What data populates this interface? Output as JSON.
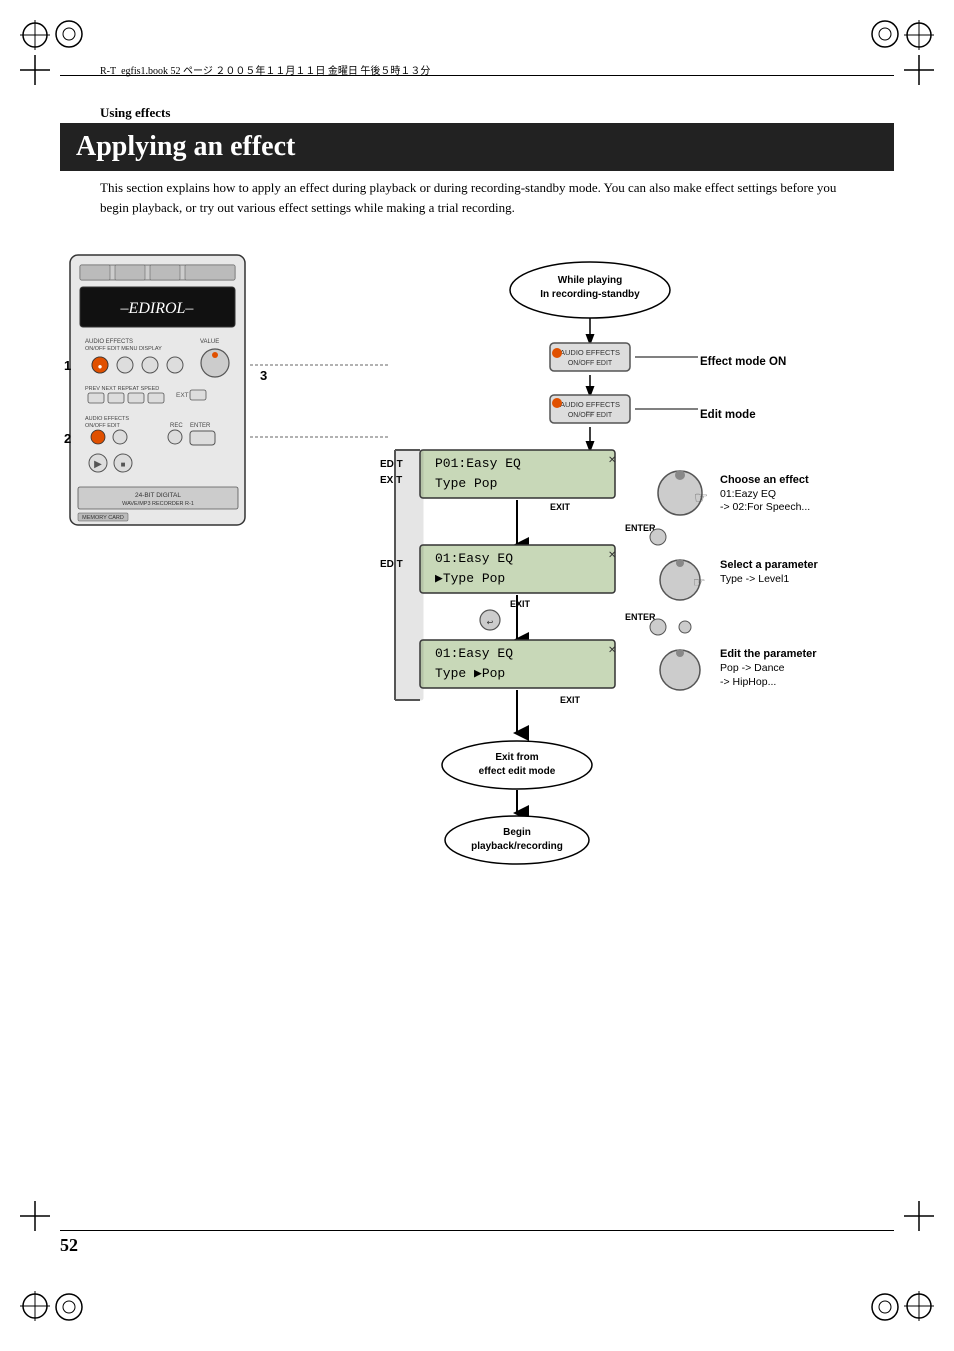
{
  "header": {
    "text": "R-T_egfis1.book  52 ページ  ２００５年１１月１１日  金曜日  午後５時１３分"
  },
  "section": {
    "label": "Using effects",
    "title": "Applying an effect",
    "body": "This section explains how to apply an effect during playback or during recording-standby mode. You can also make effect settings before you begin playback, or try out various effect settings while making a trial recording."
  },
  "diagram": {
    "while_playing_label": "While playing\nIn recording-standby",
    "step1_label": "1",
    "step2_label": "2",
    "step3_label": "3",
    "effect_mode_on": "Effect mode ON",
    "edit_mode": "Edit mode",
    "choose_effect": "Choose an effect",
    "choose_effect_detail": "01:Eazy EQ\n-> 02:For Speech...",
    "select_param": "Select a parameter",
    "select_param_detail": "Type -> Level1",
    "edit_param": "Edit the parameter",
    "edit_param_detail": "Pop -> Dance\n   -> HipHop...",
    "exit_label": "Exit from\neffect edit mode",
    "begin_label": "Begin\nplayback/recording",
    "edit_exit_left": "EDIT\nEXIT",
    "edit_left2": "EDIT",
    "enter_label": "ENTER",
    "enter_label2": "ENTER",
    "exit_btn": "EXIT",
    "exit_btn2": "EXIT",
    "exit_btn3": "EXIT",
    "screen1_top": "P01:Easy EQ",
    "screen1_bot": "Type        Pop",
    "screen2_top": "01:Easy EQ",
    "screen2_bot": "▶Type       Pop",
    "screen3_top": "01:Easy EQ",
    "screen3_bot": "Type      ▶Pop",
    "device_brand": "–EDIROL–",
    "memory_card": "MEMORY CARD",
    "device_model": "24-BIT DIGITAL\nWAVE/MP3 RECORDER R-1"
  },
  "footer": {
    "page_number": "52"
  }
}
